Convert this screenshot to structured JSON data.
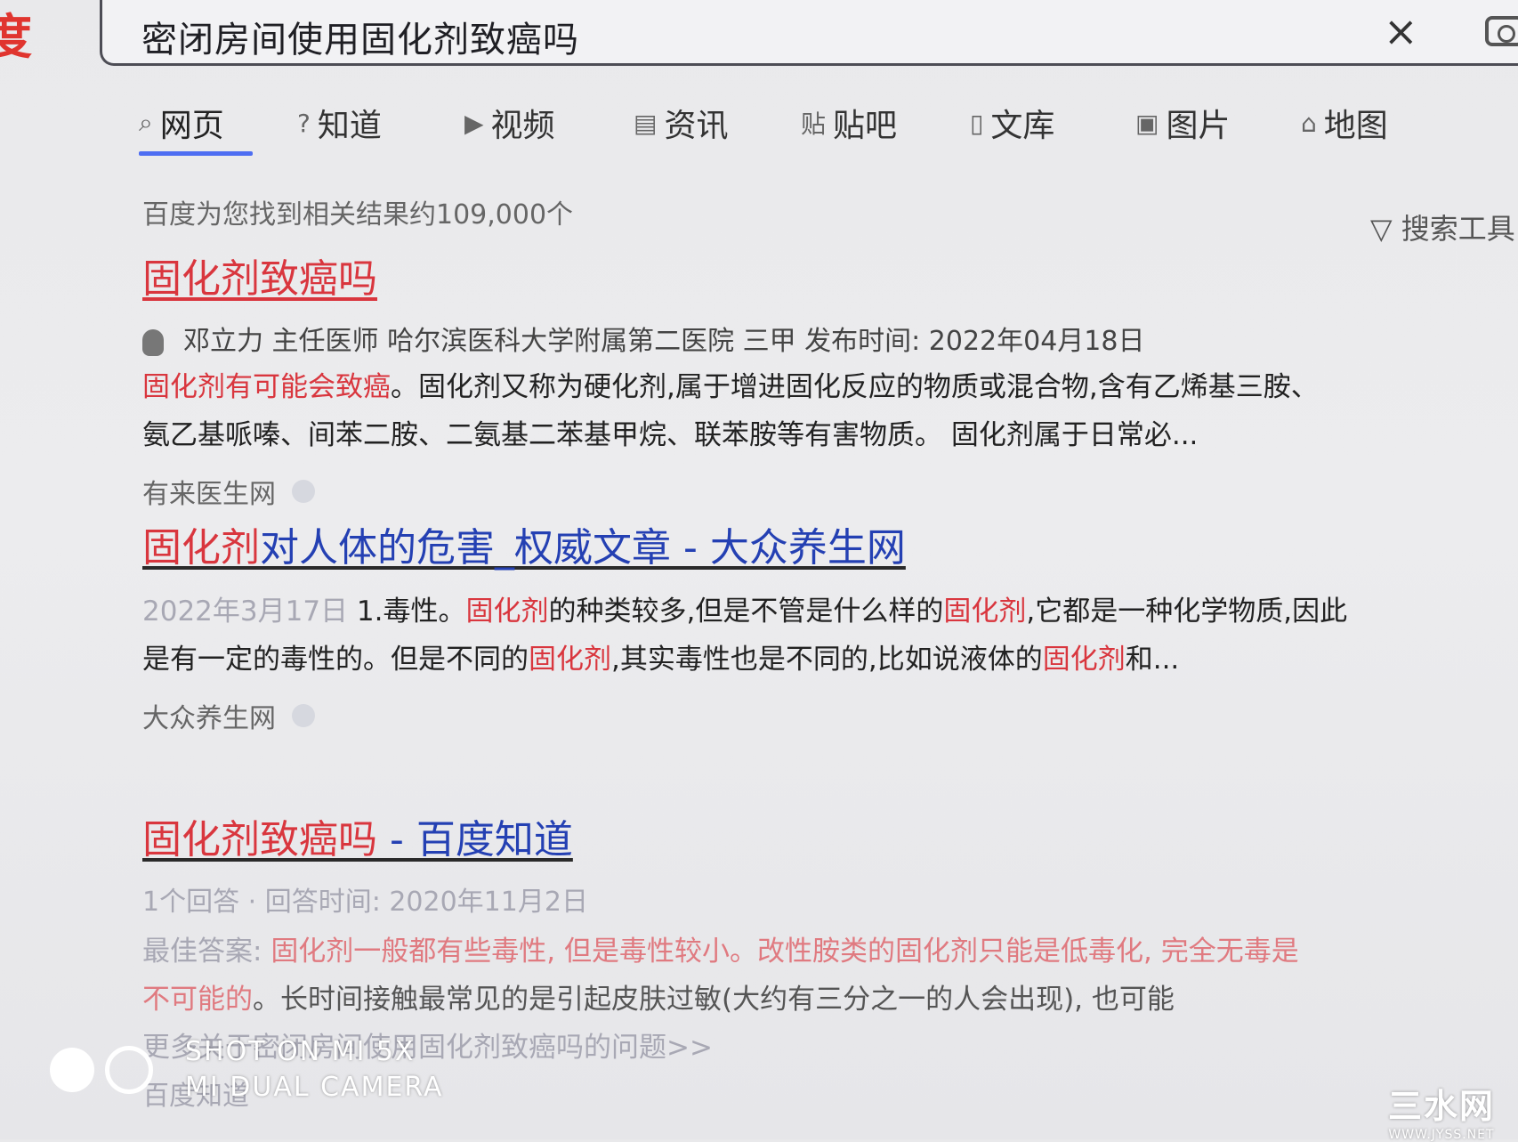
{
  "header": {
    "logo_text": "度",
    "search_query": "密闭房间使用固化剂致癌吗",
    "clear_icon": "×"
  },
  "tabs": [
    {
      "icon": "search-icon",
      "glyph": "⌕",
      "label": "网页"
    },
    {
      "icon": "question-icon",
      "glyph": "?",
      "label": "知道"
    },
    {
      "icon": "video-icon",
      "glyph": "▶",
      "label": "视频"
    },
    {
      "icon": "news-icon",
      "glyph": "▤",
      "label": "资讯"
    },
    {
      "icon": "tieba-icon",
      "glyph": "贴",
      "label": "贴吧"
    },
    {
      "icon": "doc-icon",
      "glyph": "▯",
      "label": "文库"
    },
    {
      "icon": "image-icon",
      "glyph": "▣",
      "label": "图片"
    },
    {
      "icon": "map-icon",
      "glyph": "⌂",
      "label": "地图"
    }
  ],
  "result_count": "百度为您找到相关结果约109,000个",
  "search_tools": "搜索工具",
  "results": [
    {
      "title": "固化剂致癌吗",
      "meta": "邓立力 主任医师 哈尔滨医科大学附属第二医院 三甲 发布时间: 2022年04月18日",
      "abstract_line1_red": "固化剂有可能会致癌",
      "abstract_line1_rest": "。固化剂又称为硬化剂,属于增进固化反应的物质或混合物,含有乙烯基三胺、",
      "abstract_line2": "氨乙基哌嗪、间苯二胺、二氨基二苯基甲烷、联苯胺等有害物质。 固化剂属于日常必...",
      "source": "有来医生网"
    },
    {
      "title_red": "固化剂",
      "title_blue": "对人体的危害_权威文章 - 大众养生网",
      "date": "2022年3月17日",
      "line1_a": " 1.毒性。",
      "kw": "固化剂",
      "line1_b": "的种类较多,但是不管是什么样的",
      "line1_c": ",它都是一种化学物质,因此",
      "line2_a": "是有一定的毒性的。但是不同的",
      "line2_b": ",其实毒性也是不同的,比如说液体的",
      "line2_c": "和...",
      "source": "大众养生网"
    },
    {
      "title_red": "固化剂致癌吗",
      "title_blue": " - 百度知道",
      "meta": "1个回答 · 回答时间: 2020年11月2日",
      "best_label": "最佳答案: ",
      "best_red": "固化剂一般都有些毒性, 但是毒性较小。改性胺类的固化剂只能是低毒化, 完全无毒是",
      "line2_red": "不可能的",
      "line2_rest": "。长时间接触最常见的是引起皮肤过敏(大约有三分之一的人会出现), 也可能",
      "more": "更多关于密闭房间使用固化剂致癌吗的问题>>",
      "source": "百度知道"
    }
  ],
  "watermark": {
    "line1": "SHOT ON MI 5X",
    "line2": "MI DUAL CAMERA"
  },
  "site_mark": {
    "name": "三水网",
    "url": "WWW.JYSS.NET"
  },
  "colors": {
    "keyword_red": "#d9363e",
    "link_blue": "#2440b3",
    "tab_underline": "#4e6ef2"
  }
}
